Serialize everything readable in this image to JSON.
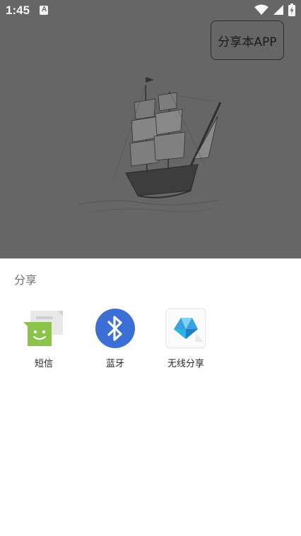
{
  "status_bar": {
    "time": "1:45",
    "notification_icon": "a-icon",
    "icons": [
      "wifi-icon",
      "signal-icon",
      "battery-charging-icon"
    ]
  },
  "app": {
    "share_button_label": "分享本APP",
    "illustration": "sailing-ship-sketch"
  },
  "share_sheet": {
    "title": "分享",
    "targets": [
      {
        "label": "短信",
        "icon": "sms-messaging-icon",
        "color": "#8bc34a"
      },
      {
        "label": "蓝牙",
        "icon": "bluetooth-icon",
        "color": "#3b6fd6"
      },
      {
        "label": "无线分享",
        "icon": "wireless-share-icon",
        "color": "#29b6e6"
      }
    ]
  },
  "colors": {
    "scrim": "#666666",
    "sheet_bg": "#ffffff"
  }
}
